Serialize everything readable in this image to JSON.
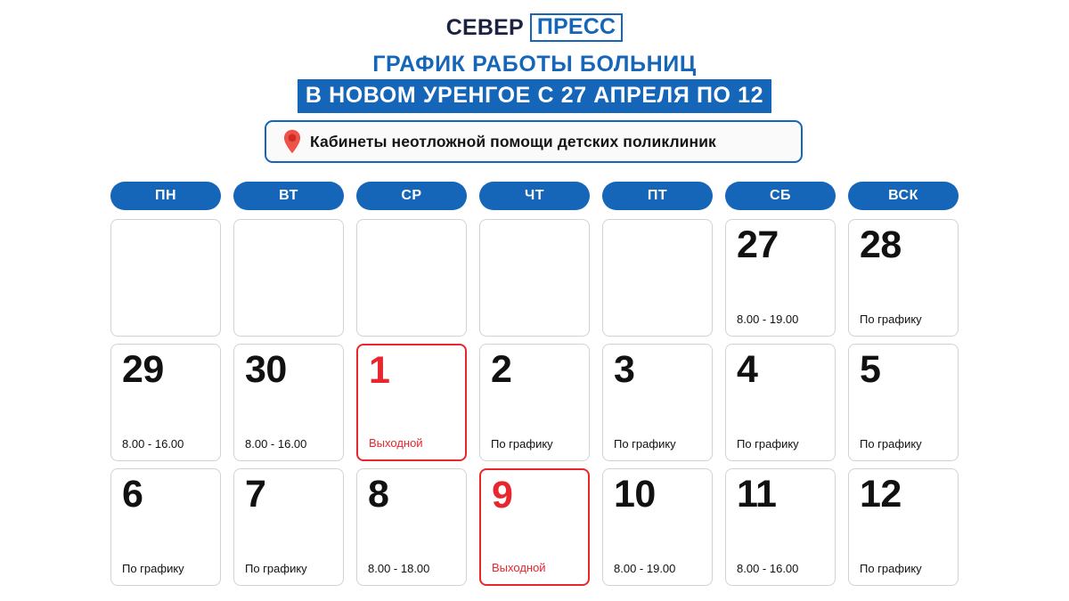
{
  "logo": {
    "word1": "СЕВЕР",
    "word2": "ПРЕСС",
    "word1_color": "#1b2340",
    "word2_color": "#1565b8"
  },
  "title": {
    "line1": "ГРАФИК РАБОТЫ БОЛЬНИЦ",
    "line2": "В НОВОМ УРЕНГОЕ С 27 АПРЕЛЯ ПО 12",
    "line1_color": "#1565b8",
    "line2_bg": "#1565b8",
    "line2_color": "#ffffff"
  },
  "subtitle": {
    "icon": "map-pin-icon",
    "icon_color": "#e8453c",
    "text": "Кабинеты неотложной помощи детских поликлиник",
    "border_color": "#1565b8"
  },
  "calendar": {
    "weekdays": [
      "ПН",
      "ВТ",
      "СР",
      "ЧТ",
      "ПТ",
      "СБ",
      "ВСК"
    ],
    "weekday_bg": "#1565b8",
    "weekday_color": "#ffffff",
    "cell_border": "#d2d2d2",
    "holiday_color": "#e8262d",
    "weeks": [
      [
        {
          "day": "",
          "note": "",
          "empty": true
        },
        {
          "day": "",
          "note": "",
          "empty": true
        },
        {
          "day": "",
          "note": "",
          "empty": true
        },
        {
          "day": "",
          "note": "",
          "empty": true
        },
        {
          "day": "",
          "note": "",
          "empty": true
        },
        {
          "day": "27",
          "note": "8.00 - 19.00",
          "empty": false
        },
        {
          "day": "28",
          "note": "По графику",
          "empty": false
        }
      ],
      [
        {
          "day": "29",
          "note": "8.00 - 16.00",
          "empty": false
        },
        {
          "day": "30",
          "note": "8.00 - 16.00",
          "empty": false
        },
        {
          "day": "1",
          "note": "Выходной",
          "empty": false,
          "holiday": true
        },
        {
          "day": "2",
          "note": "По графику",
          "empty": false
        },
        {
          "day": "3",
          "note": "По графику",
          "empty": false
        },
        {
          "day": "4",
          "note": "По графику",
          "empty": false
        },
        {
          "day": "5",
          "note": "По графику",
          "empty": false
        }
      ],
      [
        {
          "day": "6",
          "note": "По графику",
          "empty": false
        },
        {
          "day": "7",
          "note": "По графику",
          "empty": false
        },
        {
          "day": "8",
          "note": "8.00 - 18.00",
          "empty": false
        },
        {
          "day": "9",
          "note": "Выходной",
          "empty": false,
          "holiday": true
        },
        {
          "day": "10",
          "note": "8.00 - 19.00",
          "empty": false
        },
        {
          "day": "11",
          "note": "8.00 - 16.00",
          "empty": false
        },
        {
          "day": "12",
          "note": "По графику",
          "empty": false
        }
      ]
    ]
  }
}
